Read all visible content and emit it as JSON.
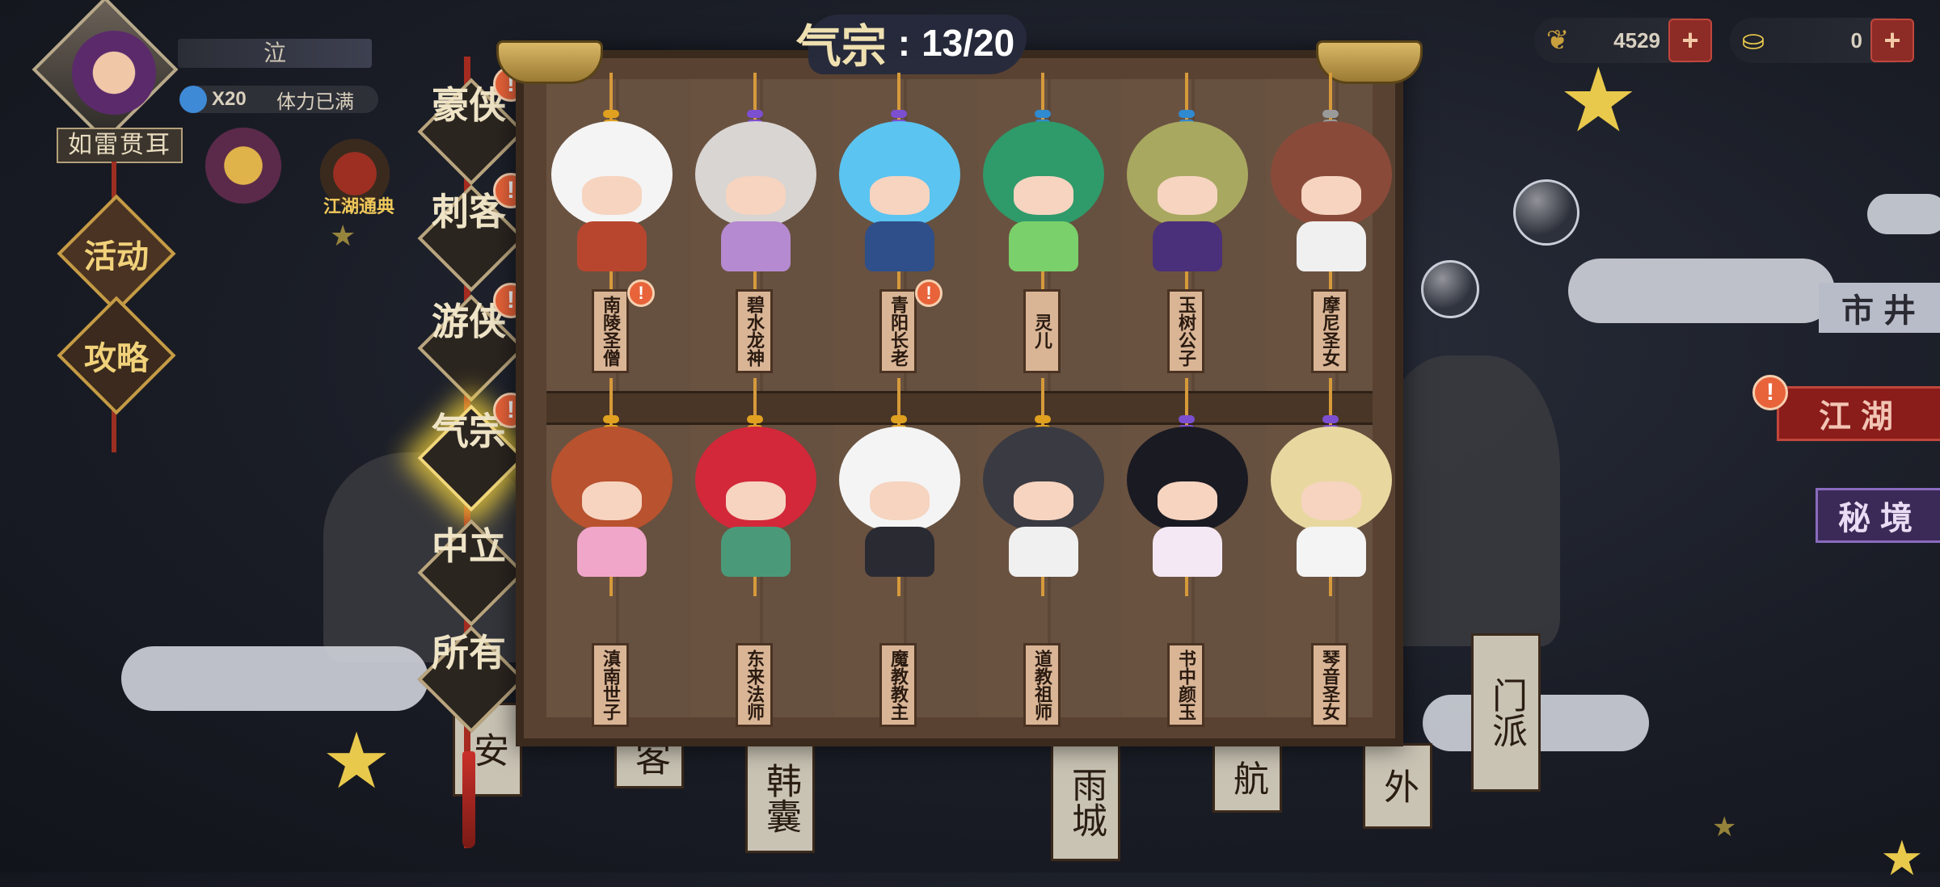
{
  "player": {
    "name": "泣",
    "stamina_count": "X20",
    "stamina_status": "体力已满",
    "title": "如雷贯耳"
  },
  "left_menu": {
    "activity_label": "活动",
    "strategy_label": "攻略",
    "event_label": "江湖通典"
  },
  "currency": {
    "coins": "4529",
    "ingots": "0",
    "plus": "+"
  },
  "right_nav": {
    "market": "市井",
    "jianghu": "江湖",
    "secret": "秘境",
    "sect": "门派"
  },
  "collection": {
    "category": "气宗",
    "separator": ":",
    "progress": "13/20"
  },
  "categories": [
    {
      "label": "豪侠",
      "alert": true,
      "active": false
    },
    {
      "label": "刺客",
      "alert": true,
      "active": false
    },
    {
      "label": "游侠",
      "alert": true,
      "active": false
    },
    {
      "label": "气宗",
      "alert": true,
      "active": true
    },
    {
      "label": "中立",
      "alert": false,
      "active": false
    },
    {
      "label": "所有",
      "alert": false,
      "active": false
    }
  ],
  "alert_mark": "!",
  "dolls_top": [
    {
      "name": "南陵圣僧",
      "alert": true
    },
    {
      "name": "碧水龙神",
      "alert": false
    },
    {
      "name": "青阳长老",
      "alert": true
    },
    {
      "name": "灵儿",
      "alert": false
    },
    {
      "name": "玉树公子",
      "alert": false
    },
    {
      "name": "摩尼圣女",
      "alert": false
    }
  ],
  "dolls_bottom": [
    {
      "name": "滇南世子",
      "alert": false
    },
    {
      "name": "东来法师",
      "alert": false
    },
    {
      "name": "魔教教主",
      "alert": false
    },
    {
      "name": "道教祖师",
      "alert": false
    },
    {
      "name": "书中颜玉",
      "alert": false
    },
    {
      "name": "琴音圣女",
      "alert": false
    }
  ],
  "colors": {
    "cabinet": "#5a4232",
    "rope": "#a52a1f",
    "alert": "#e8633a",
    "gold": "#e9c94c"
  }
}
